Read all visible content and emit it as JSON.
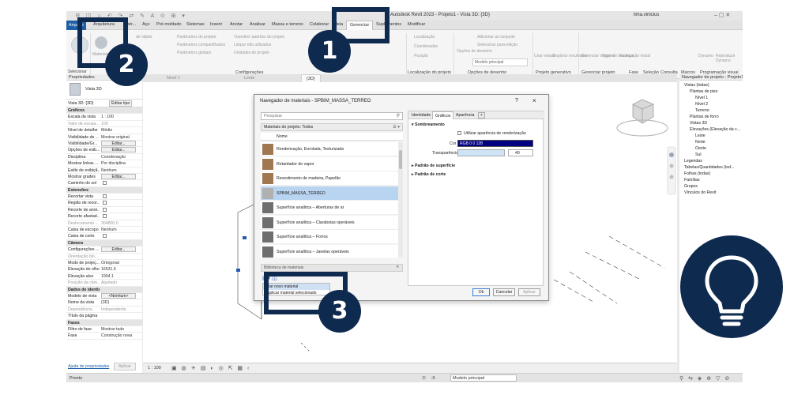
{
  "titlebar": {
    "title": "Autodesk Revit 2023 - Projeto1 - Vista 3D: {3D}",
    "user": "lima.vinicius"
  },
  "tabs": [
    {
      "label": "Arquivo"
    },
    {
      "label": "Arquitetura"
    },
    {
      "label": "Estr..."
    },
    {
      "label": "Aço"
    },
    {
      "label": "Pré-moldado"
    },
    {
      "label": "Sistemas"
    },
    {
      "label": "Inserir"
    },
    {
      "label": "Anotar"
    },
    {
      "label": "Analisar"
    },
    {
      "label": "Massa e terreno"
    },
    {
      "label": "Colaborar"
    },
    {
      "label": "Vista"
    },
    {
      "label": "Gerenciar"
    },
    {
      "label": "Suplementos"
    },
    {
      "label": "Modificar"
    }
  ],
  "ribbon": {
    "select_label": "Selecionar",
    "items": {
      "i1": "Materiais",
      "i2": "de objeto",
      "i3": "Parâmetros do projeto",
      "i4": "Parâmetros compartilhados",
      "i5": "Parâmetros globais",
      "i6": "Transferir padrões do projeto",
      "i7": "Limpar não utilizados",
      "i8": "Unidades do projeto",
      "i9": "Localização",
      "i10": "Coordenadas",
      "i11": "Posição",
      "i12": "Opções de desenho",
      "i13": "Adicionar ao conjunto",
      "i14": "Selecionar para edição",
      "i15": "Modelo principal",
      "i16": "Criar estudo",
      "i17": "Explorar resultados",
      "i18": "Gerenciar imagens",
      "i19": "Tipos de decalque",
      "i20": "Navegação inicial",
      "i21": "Dynamo",
      "i22": "Reproduzir Dynamo"
    },
    "groups": {
      "g1": "Configurações",
      "g2": "Localização do projeto",
      "g3": "Opções de desenho",
      "g4": "Projeto generativo",
      "g5": "Gerenciar projeto",
      "g6": "Fase",
      "g7": "Seleção",
      "g8": "Consulta",
      "g9": "Macros",
      "g10": "Programação visual"
    }
  },
  "properties": {
    "header": "Propriedades",
    "type_name": "Vista 3D",
    "type_selector": "Vista 3D: {3D}",
    "edit_type": "Editar tipo",
    "rows": [
      {
        "k": "Gráficos",
        "v": "",
        "kind": "sec"
      },
      {
        "k": "Escala da vista",
        "v": "1 : 100"
      },
      {
        "k": "Valor de escala...",
        "v": "100",
        "kind": "dim"
      },
      {
        "k": "Nível de detalhe",
        "v": "Médio"
      },
      {
        "k": "Visibilidade de ...",
        "v": "Mostrar original"
      },
      {
        "k": "Visibilidade/Gr...",
        "v": "Editar...",
        "kind": "btn"
      },
      {
        "k": "Opções de exib...",
        "v": "Editar...",
        "kind": "btn"
      },
      {
        "k": "Disciplina",
        "v": "Coordenação"
      },
      {
        "k": "Mostrar linhas ...",
        "v": "Por disciplina"
      },
      {
        "k": "Estilo de exibiçã...",
        "v": "Nenhum"
      },
      {
        "k": "Mostrar grades",
        "v": "Editar...",
        "kind": "btn"
      },
      {
        "k": "Caminho do sol",
        "v": "",
        "kind": "cb"
      },
      {
        "k": "Extensões",
        "v": "",
        "kind": "sec"
      },
      {
        "k": "Recortar vista",
        "v": "",
        "kind": "cb"
      },
      {
        "k": "Região de recor...",
        "v": "",
        "kind": "cb"
      },
      {
        "k": "Recorte de anot...",
        "v": "",
        "kind": "cb"
      },
      {
        "k": "Recorte afastad...",
        "v": "",
        "kind": "cb"
      },
      {
        "k": "Deslocamento ...",
        "v": "304800.0",
        "kind": "dim"
      },
      {
        "k": "Caixa de escopo",
        "v": "Nenhum"
      },
      {
        "k": "Caixa de corte",
        "v": "",
        "kind": "cb"
      },
      {
        "k": "Câmera",
        "v": "",
        "kind": "sec"
      },
      {
        "k": "Configurações ...",
        "v": "Editar...",
        "kind": "btn"
      },
      {
        "k": "Orientação blo...",
        "v": "",
        "kind": "dim"
      },
      {
        "k": "Modo de projeç...",
        "v": "Ortogonal"
      },
      {
        "k": "Elevação do olho",
        "v": "16531.6"
      },
      {
        "k": "Elevação alvo",
        "v": "1904.1"
      },
      {
        "k": "Posição da câm...",
        "v": "Ajustado",
        "kind": "dim"
      },
      {
        "k": "Dados de identidade",
        "v": "",
        "kind": "sec"
      },
      {
        "k": "Modelo de vista",
        "v": "<Nenhum>",
        "kind": "btn"
      },
      {
        "k": "Nome da vista",
        "v": "{3D}"
      },
      {
        "k": "Dependência",
        "v": "Independente",
        "kind": "dim"
      },
      {
        "k": "Título da página",
        "v": ""
      },
      {
        "k": "Fases",
        "v": "",
        "kind": "sec"
      },
      {
        "k": "Filtro de fase",
        "v": "Mostrar tudo"
      },
      {
        "k": "Fase",
        "v": "Construção nova"
      }
    ],
    "help_link": "Ajuda de propriedades",
    "apply": "Aplicar"
  },
  "view_tabs": [
    {
      "label": "Nível 1"
    },
    {
      "label": "Leste"
    },
    {
      "label": "{3D}"
    }
  ],
  "browser": {
    "header": "Navegador de projeto - Projeto1",
    "rows": [
      {
        "label": "Vistas (todas)",
        "indent": 0
      },
      {
        "label": "Plantas de piso",
        "indent": 1
      },
      {
        "label": "Nível 1",
        "indent": 2
      },
      {
        "label": "Nível 2",
        "indent": 2
      },
      {
        "label": "Terreno",
        "indent": 2
      },
      {
        "label": "Plantas de forro",
        "indent": 1
      },
      {
        "label": "Vistas 3D",
        "indent": 1
      },
      {
        "label": "Elevações (Elevação da c...",
        "indent": 1
      },
      {
        "label": "Leste",
        "indent": 2
      },
      {
        "label": "Norte",
        "indent": 2
      },
      {
        "label": "Oeste",
        "indent": 2
      },
      {
        "label": "Sul",
        "indent": 2
      },
      {
        "label": "Legendas",
        "indent": 0
      },
      {
        "label": "Tabelas/Quantidades (tod...",
        "indent": 0
      },
      {
        "label": "Folhas (todas)",
        "indent": 0
      },
      {
        "label": "Famílias",
        "indent": 0
      },
      {
        "label": "Grupos",
        "indent": 0
      },
      {
        "label": "Vínculos do Revit",
        "indent": 0
      }
    ]
  },
  "dialog": {
    "title": "Navegador de materiais - SPBIM_MASSA_TERREO",
    "help": "?",
    "close": "×",
    "search_placeholder": "Pesquisar",
    "library": "Materiais do projeto: Todos",
    "column_name": "Nome",
    "materials": [
      {
        "name": "Renderização, Enrolada, Texturizada",
        "sel": false
      },
      {
        "name": "Retardador de vapor",
        "sel": false
      },
      {
        "name": "Revestimento de madeira, Papelão",
        "sel": false
      },
      {
        "name": "SPBIM_MASSA_TERREO",
        "sel": true
      },
      {
        "name": "Superfície analítica – Aberturas de ar",
        "sel": false
      },
      {
        "name": "Superfície analítica – Claraboias operáveis",
        "sel": false
      },
      {
        "name": "Superfície analítica – Forros",
        "sel": false
      },
      {
        "name": "Superfície analítica – Janelas operáveis",
        "sel": false
      }
    ],
    "tabs": [
      {
        "label": "Identidade"
      },
      {
        "label": "Gráficos"
      },
      {
        "label": "Aparência"
      },
      {
        "label": "+"
      }
    ],
    "shading_header": "Sombreamento",
    "use_render": "Utilizar aparência de renderização",
    "color_label": "Cor",
    "color_value": "RGB 0 0 128",
    "transparency_label": "Transparência",
    "transparency_value": "40",
    "surface_pattern": "Padrão de superfície",
    "cut_pattern": "Padrão de corte",
    "library_panel": "Biblioteca de materiais",
    "menu_create": "Criar novo material",
    "menu_duplicate": "Duplicar material selecionado",
    "ok": "Ok",
    "cancel": "Cancelar",
    "apply": "Aplicar"
  },
  "viewbar": {
    "scale": "1 : 100"
  },
  "statusbar": {
    "left": "Pronto",
    "center": "Modelo principal",
    "zoom": ":0"
  },
  "markers": {
    "m1": "1",
    "m2": "2",
    "m3": "3"
  },
  "colors": {
    "accent_navy": "#0f2a4f",
    "revit_blue": "#1f5fa8",
    "selection": "#b8d4f0",
    "material_color": "#000080"
  }
}
